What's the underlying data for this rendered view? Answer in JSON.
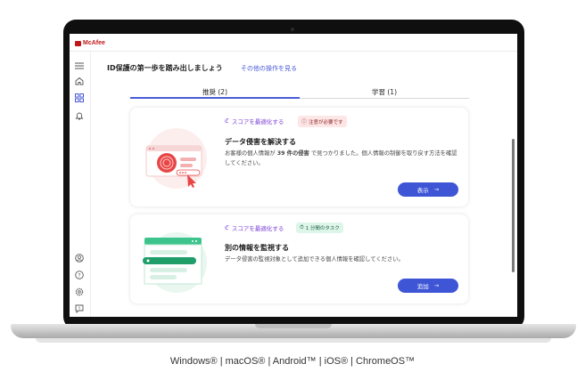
{
  "app": {
    "brand": "McAfee"
  },
  "sidebar": {
    "icons": [
      "menu-icon",
      "home-icon",
      "apps-grid-icon",
      "bell-icon",
      "account-icon",
      "help-icon",
      "settings-icon",
      "feedback-icon"
    ]
  },
  "main": {
    "heading": "ID保護の第一歩を踏み出しましょう",
    "other_actions_link": "その他の操作を見る",
    "tabs": [
      {
        "label": "推奨 (2)",
        "active": true
      },
      {
        "label": "学習 (1)",
        "active": false
      }
    ],
    "cards": [
      {
        "category": "スコアを最適化する",
        "badge": "注意が必要です",
        "title": "データ侵害を解決する",
        "desc_prefix": "お客様の個人情報が ",
        "desc_bold": "39 件の侵害",
        "desc_suffix": " で見つかりました。個人情報の制御を取り戻す方法を確認してください。",
        "button": "表示"
      },
      {
        "category": "スコアを最適化する",
        "badge": "1 分間のタスク",
        "title": "別の情報を監視する",
        "desc": "データ侵害の監視対象として追加できる個人情報を確認してください。",
        "button": "追加"
      }
    ]
  },
  "footer": {
    "platforms": "Windows® | macOS® | Android™ | iOS® | ChromeOS™"
  },
  "colors": {
    "accent": "#3e55d6",
    "brand": "#c01818",
    "category": "#7b3fd6"
  }
}
